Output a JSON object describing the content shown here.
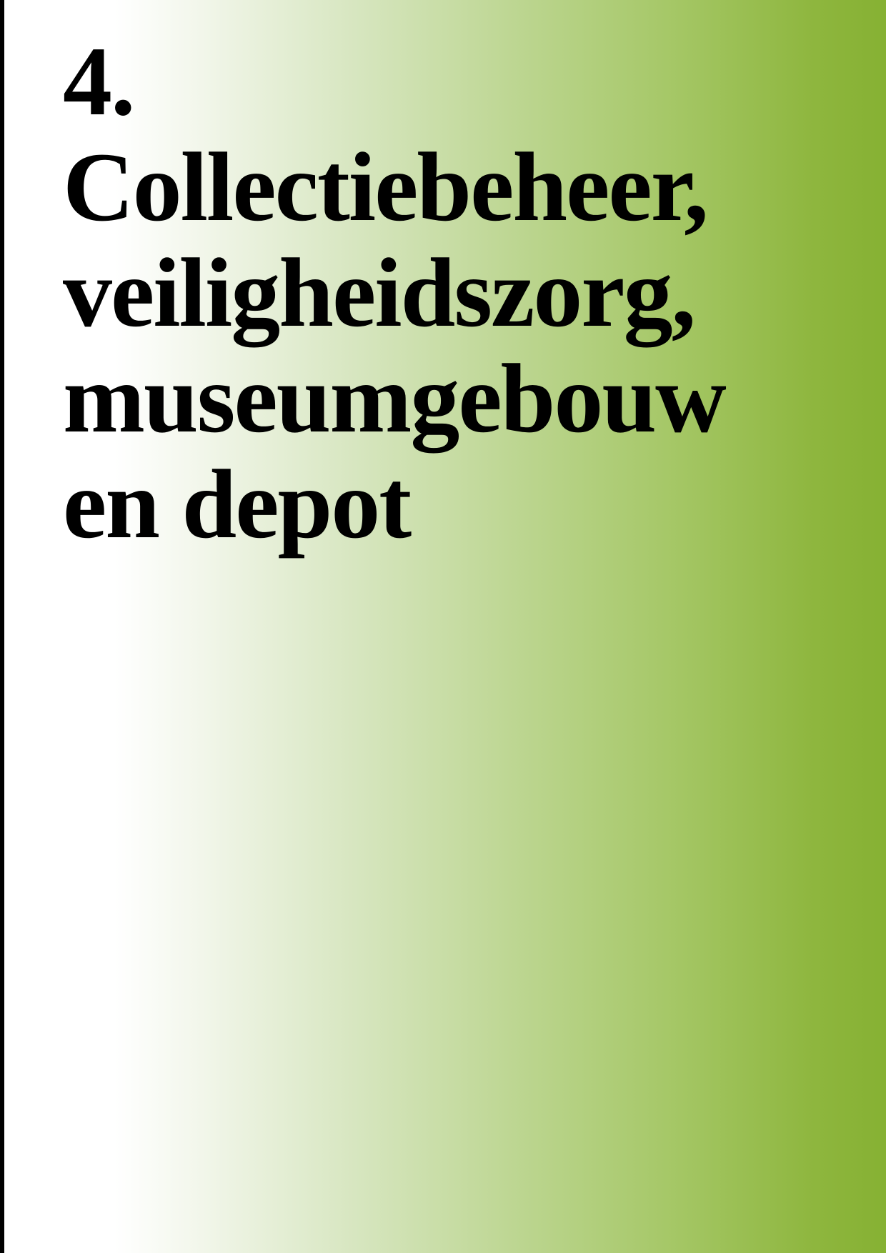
{
  "chapter": {
    "number": "4.",
    "title_lines": [
      "Collectiebeheer,",
      "veiligheidszorg,",
      "museumgebouw",
      "en depot"
    ]
  },
  "colors": {
    "background_start": "#ffffff",
    "background_end": "#86b133",
    "text": "#000000",
    "left_rule": "#000000"
  }
}
